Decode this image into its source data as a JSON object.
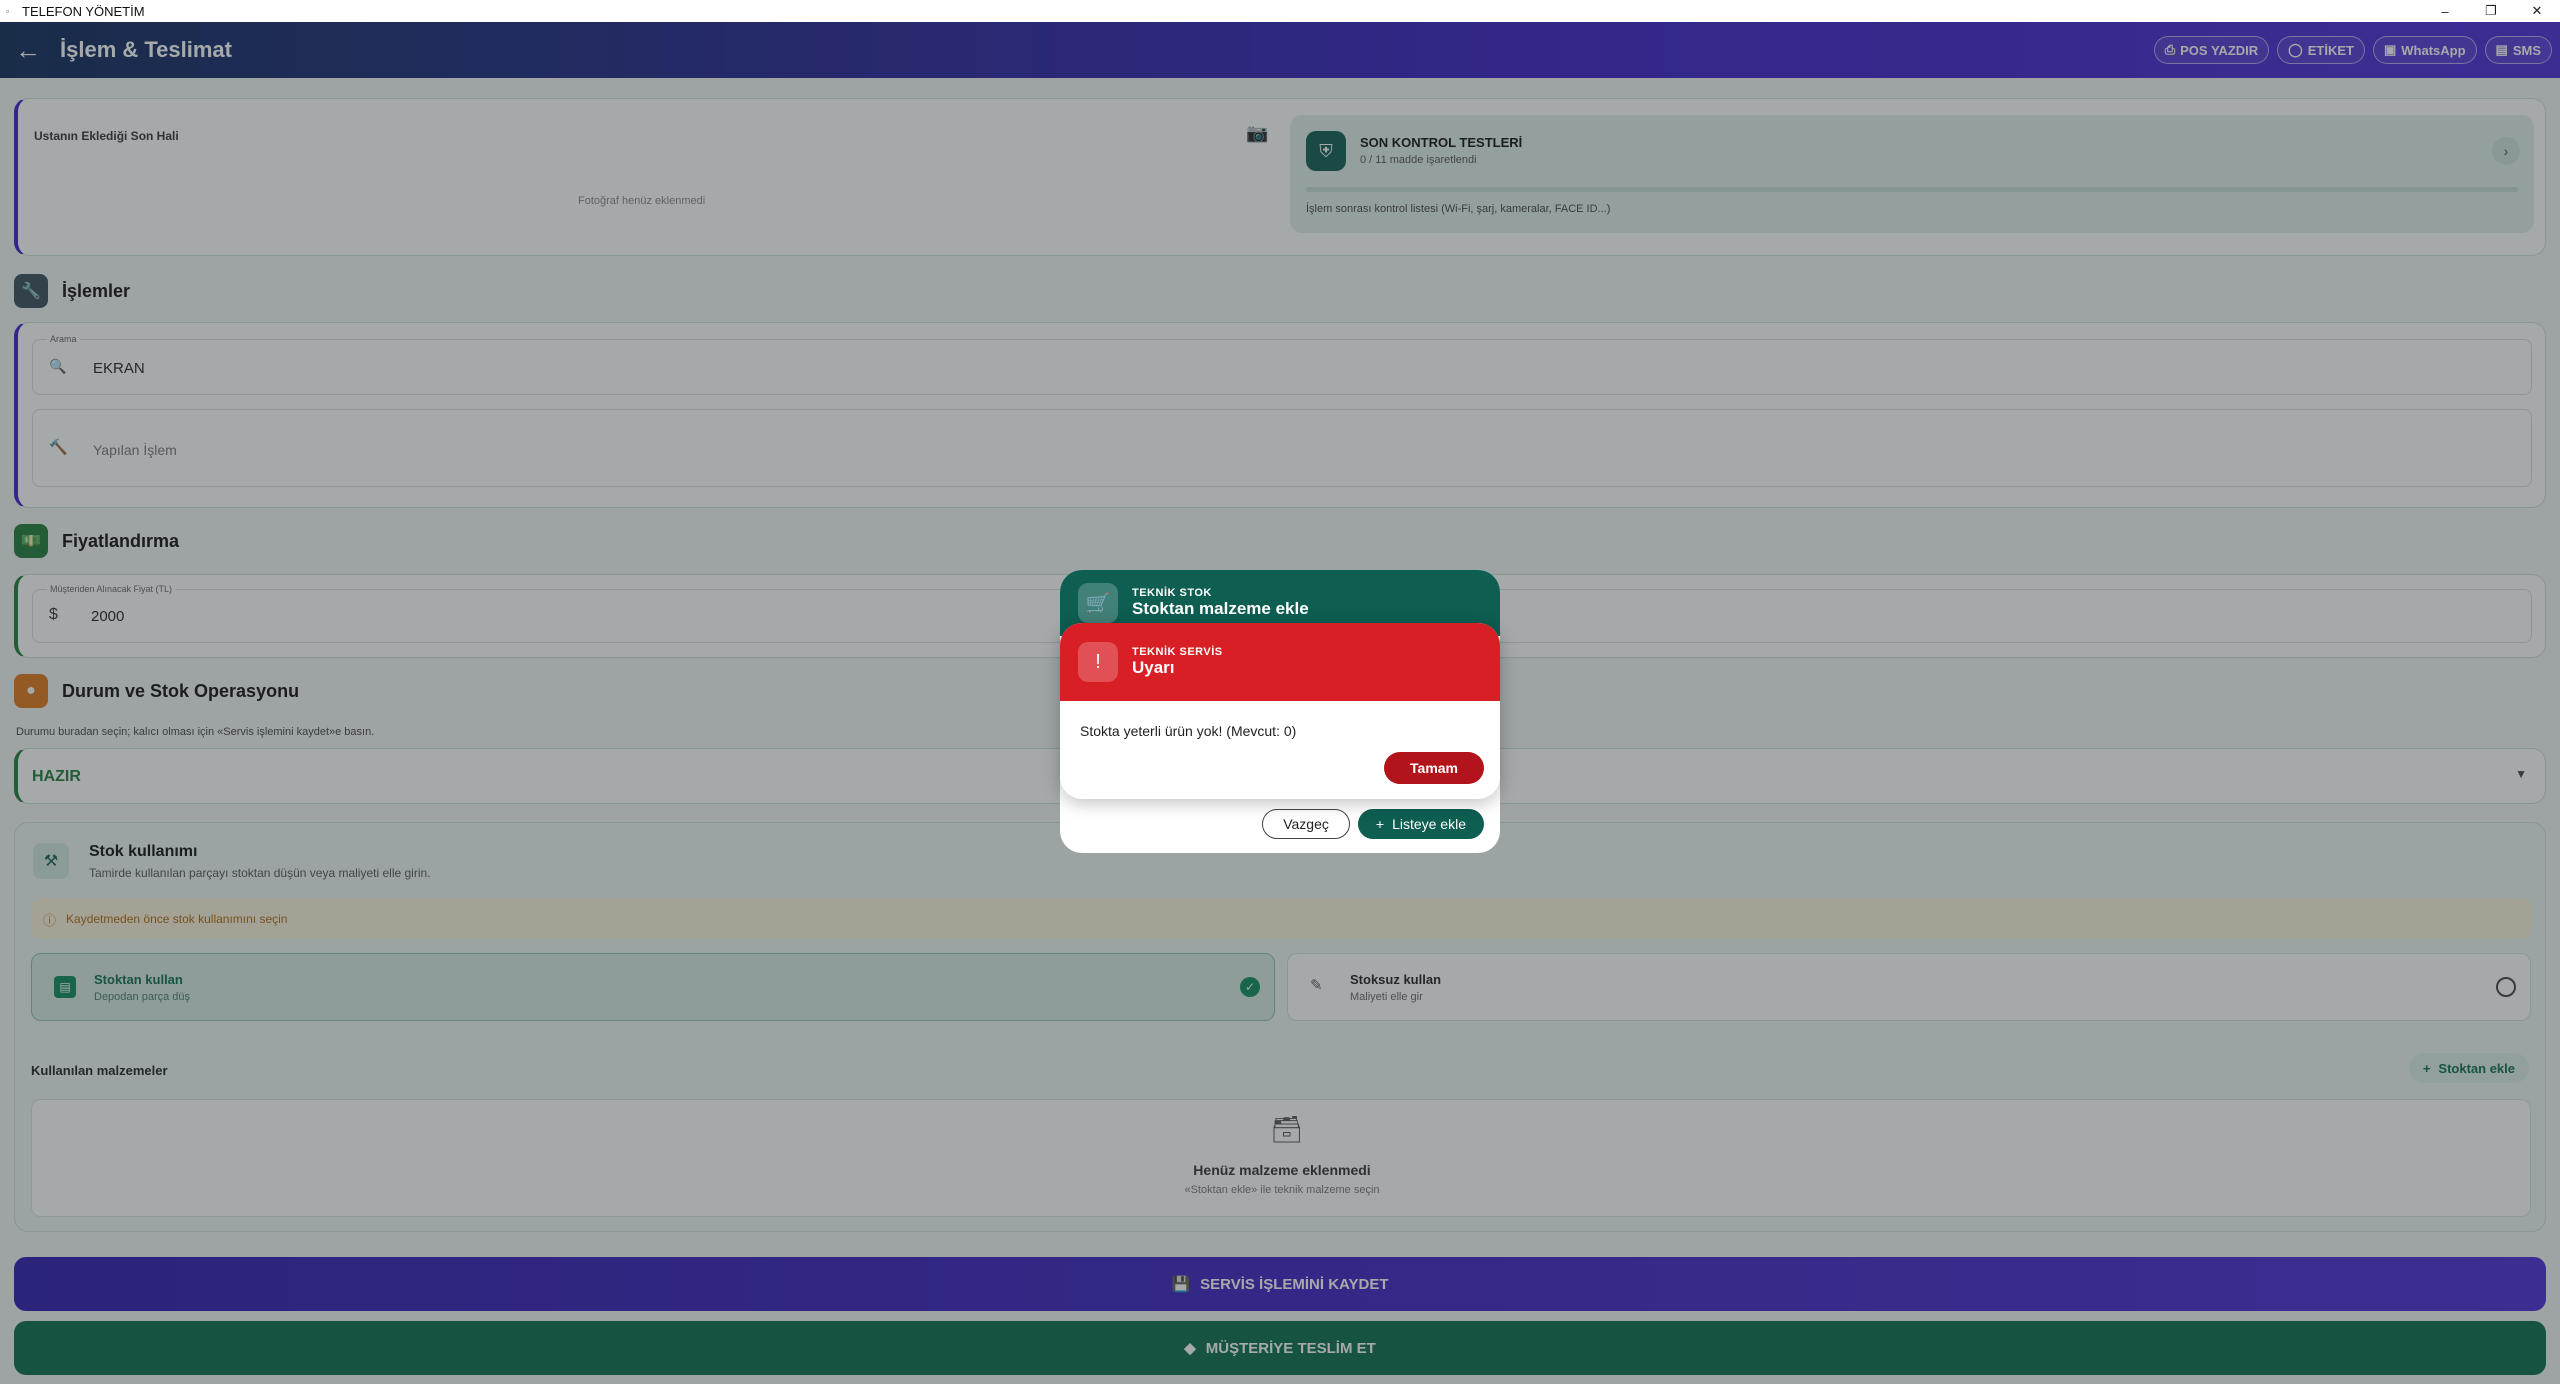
{
  "window": {
    "title": "TELEFON YÖNETİM"
  },
  "appbar": {
    "title": "İşlem & Teslimat",
    "actions": [
      "POS YAZDIR",
      "ETİKET",
      "WhatsApp",
      "SMS"
    ]
  },
  "photo_section": {
    "label": "Ustanın Eklediği Son Hali",
    "empty_text": "Fotoğraf henüz eklenmedi"
  },
  "control_tests": {
    "title": "SON KONTROL TESTLERİ",
    "progress_text": "0 / 11 madde işaretlendi",
    "progress": 0,
    "description": "İşlem sonrası kontrol listesi (Wi-Fi, şarj, kameralar, FACE ID...)"
  },
  "operations": {
    "heading": "İşlemler",
    "search_label": "Arama",
    "search_value": "EKRAN",
    "work_placeholder": "Yapılan İşlem"
  },
  "pricing": {
    "heading": "Fiyatlandırma",
    "price_label": "Müşteriden Alınacak Fiyat (TL)",
    "currency_symbol": "$",
    "price_value": "2000"
  },
  "status": {
    "heading": "Durum ve Stok Operasyonu",
    "hint": "Durumu buradan seçin; kalıcı olması için «Servis işlemini kaydet»e basın.",
    "selected": "HAZIR"
  },
  "stock_usage": {
    "title": "Stok kullanımı",
    "subtitle": "Tamirde kullanılan parçayı stoktan düşün veya maliyeti elle girin.",
    "warning": "Kaydetmeden önce stok kullanımını seçin",
    "option_stock_title": "Stoktan kullan",
    "option_stock_sub": "Depodan parça düş",
    "option_nostock_title": "Stoksuz kullan",
    "option_nostock_sub": "Maliyeti elle gir",
    "materials_heading": "Kullanılan malzemeler",
    "add_from_stock": "Stoktan ekle",
    "empty_title": "Henüz malzeme eklenmedi",
    "empty_sub": "«Stoktan ekle» ile teknik malzeme seçin"
  },
  "bottom_buttons": {
    "save": "SERVİS İŞLEMİNİ KAYDET",
    "deliver": "MÜŞTERİYE TESLİM ET"
  },
  "stock_dialog": {
    "subtitle": "TEKNİK STOK",
    "title": "Stoktan malzeme ekle",
    "cancel": "Vazgeç",
    "add": "Listeye ekle"
  },
  "warning_dialog": {
    "subtitle": "TEKNİK SERVİS",
    "title": "Uyarı",
    "message": "Stokta yeterli ürün yok! (Mevcut: 0)",
    "ok": "Tamam"
  },
  "colors": {
    "primary": "#3a1fc9",
    "teal": "#0e5e52",
    "danger": "#d81f26",
    "success": "#0b6b4e"
  }
}
